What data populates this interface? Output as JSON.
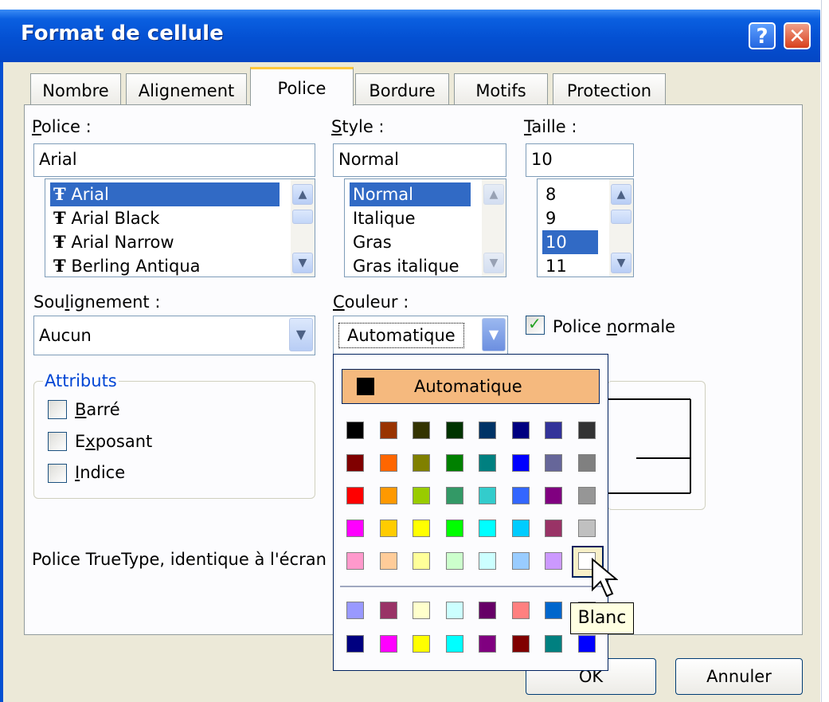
{
  "window": {
    "title": "Format de cellule",
    "help_label": "?",
    "close_label": "✕"
  },
  "tabs": [
    {
      "label": "Nombre"
    },
    {
      "label": "Alignement"
    },
    {
      "label": "Police"
    },
    {
      "label": "Bordure"
    },
    {
      "label": "Motifs"
    },
    {
      "label": "Protection"
    }
  ],
  "active_tab": "Police",
  "font": {
    "label_key": "P",
    "label_rest": "olice :",
    "value": "Arial",
    "items": [
      {
        "label": "Arial",
        "selected": true
      },
      {
        "label": "Arial Black",
        "selected": false
      },
      {
        "label": "Arial Narrow",
        "selected": false
      },
      {
        "label": "Berling Antiqua",
        "selected": false
      }
    ],
    "item_icon": "truetype-icon"
  },
  "style": {
    "label_key": "S",
    "label_rest": "tyle :",
    "value": "Normal",
    "items": [
      {
        "label": "Normal",
        "selected": true
      },
      {
        "label": "Italique",
        "selected": false
      },
      {
        "label": "Gras",
        "selected": false
      },
      {
        "label": "Gras italique",
        "selected": false
      }
    ]
  },
  "size": {
    "label_key": "T",
    "label_rest": "aille :",
    "value": "10",
    "items": [
      {
        "label": "8",
        "selected": false
      },
      {
        "label": "9",
        "selected": false
      },
      {
        "label": "10",
        "selected": true
      },
      {
        "label": "11",
        "selected": false
      }
    ]
  },
  "underline": {
    "label_pre": "Sou",
    "label_key": "l",
    "label_post": "ignement :",
    "value": "Aucun"
  },
  "color": {
    "label_pre": "",
    "label_key": "C",
    "label_post": "ouleur :",
    "value": "Automatique"
  },
  "normal_font": {
    "label_pre": "Police ",
    "label_key": "n",
    "label_post": "ormale",
    "checked": true
  },
  "attributes": {
    "title": "Attributs",
    "items": [
      {
        "key": "B",
        "rest": "arré",
        "pre": "",
        "checked": false
      },
      {
        "key": "x",
        "rest": "posant",
        "pre": "E",
        "checked": false
      },
      {
        "key": "I",
        "rest": "ndice",
        "pre": "",
        "checked": false
      }
    ]
  },
  "info_text": "Police TrueType, identique à l'écran",
  "palette": {
    "automatic_label": "Automatique",
    "automatic_color": "#000000",
    "hovered": "Blanc",
    "grid": [
      [
        "#000000",
        "#993300",
        "#333300",
        "#003300",
        "#003366",
        "#000080",
        "#333399",
        "#333333"
      ],
      [
        "#800000",
        "#FF6600",
        "#808000",
        "#008000",
        "#008080",
        "#0000FF",
        "#666699",
        "#808080"
      ],
      [
        "#FF0000",
        "#FF9900",
        "#99CC00",
        "#339966",
        "#33CCCC",
        "#3366FF",
        "#800080",
        "#969696"
      ],
      [
        "#FF00FF",
        "#FFCC00",
        "#FFFF00",
        "#00FF00",
        "#00FFFF",
        "#00CCFF",
        "#993366",
        "#C0C0C0"
      ],
      [
        "#FF99CC",
        "#FFCC99",
        "#FFFF99",
        "#CCFFCC",
        "#CCFFFF",
        "#99CCFF",
        "#CC99FF",
        "#FFFFFF"
      ]
    ],
    "extra": [
      [
        "#9999FF",
        "#993366",
        "#FFFFCC",
        "#CCFFFF",
        "#660066",
        "#FF8080",
        "#0066CC",
        "#CCCCFF"
      ],
      [
        "#000080",
        "#FF00FF",
        "#FFFF00",
        "#00FFFF",
        "#800080",
        "#800000",
        "#008080",
        "#0000FF"
      ]
    ]
  },
  "buttons": {
    "ok": "OK",
    "cancel": "Annuler"
  }
}
